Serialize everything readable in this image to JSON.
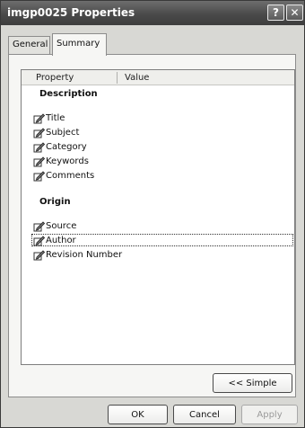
{
  "window": {
    "title": "imgp0025 Properties",
    "help_glyph": "?",
    "close_glyph": "✕"
  },
  "tabs": [
    {
      "label": "General",
      "selected": false
    },
    {
      "label": "Summary",
      "selected": true
    }
  ],
  "list": {
    "columns": {
      "property": "Property",
      "value": "Value"
    },
    "groups": [
      {
        "title": "Description",
        "items": [
          "Title",
          "Subject",
          "Category",
          "Keywords",
          "Comments"
        ]
      },
      {
        "title": "Origin",
        "items": [
          "Source",
          "Author",
          "Revision Number"
        ]
      }
    ],
    "focused_item": "Author"
  },
  "buttons": {
    "simple": "<< Simple",
    "ok": "OK",
    "cancel": "Cancel",
    "apply": "Apply"
  },
  "icons": {
    "row_icon": "edit-pencil-icon"
  }
}
